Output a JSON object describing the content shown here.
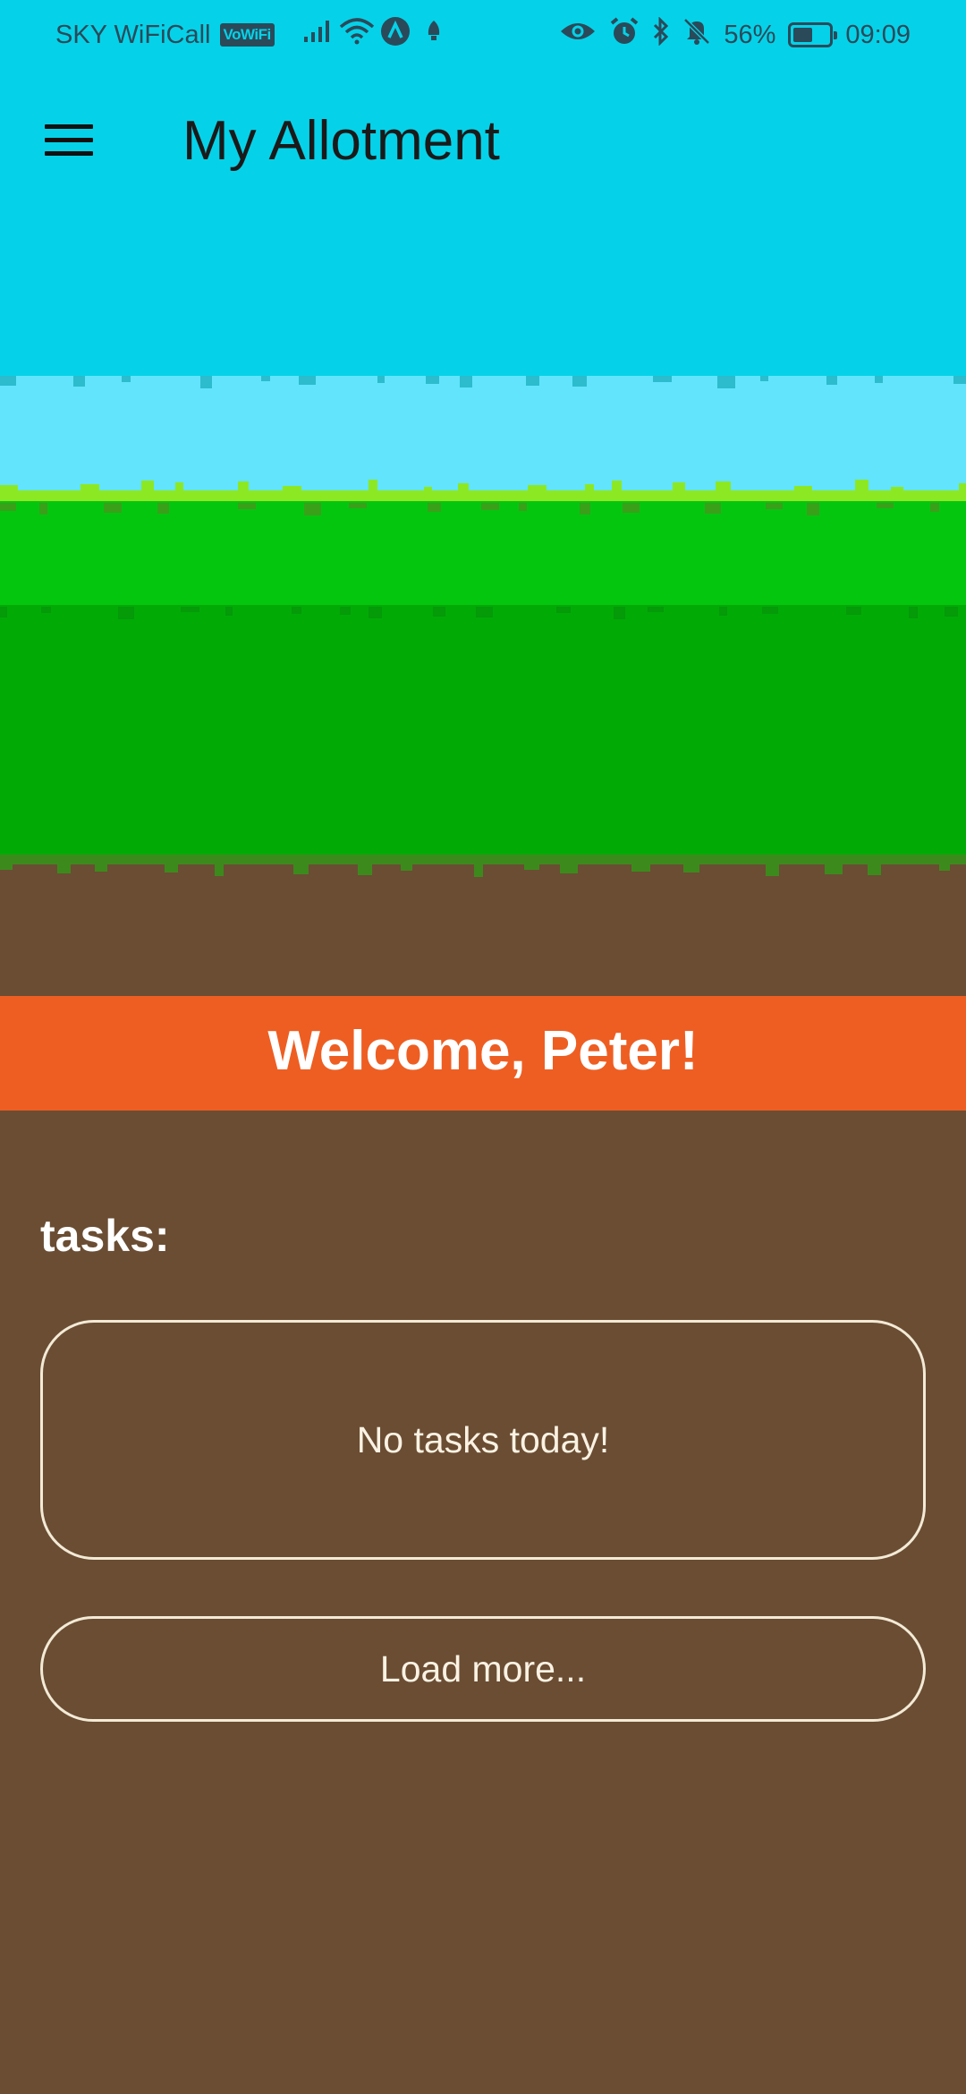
{
  "status_bar": {
    "carrier": "SKY WiFiCall",
    "vowifi_badge": "VoWiFi",
    "battery_percent": "56%",
    "battery_level": 0.56,
    "time": "09:09",
    "icons": [
      "signal-icon",
      "wifi-icon",
      "vpn-icon",
      "rocket-icon",
      "eye-icon",
      "alarm-icon",
      "bluetooth-icon",
      "mute-icon",
      "battery-icon"
    ]
  },
  "app_bar": {
    "title": "My Allotment",
    "menu_icon": "hamburger-menu-icon"
  },
  "scenery": {
    "sky_color": "#05d2e8",
    "horizon_color": "#62e4fd",
    "grass_top_color": "#05c60f",
    "grass_color": "#02aa06",
    "grass_highlight_color": "#8de824",
    "soil_color": "#6a4d33"
  },
  "welcome": {
    "text": "Welcome, Peter!",
    "color": "#ee5e22"
  },
  "tasks": {
    "heading": "tasks:",
    "empty_message": "No tasks today!",
    "load_more_label": "Load more..."
  }
}
